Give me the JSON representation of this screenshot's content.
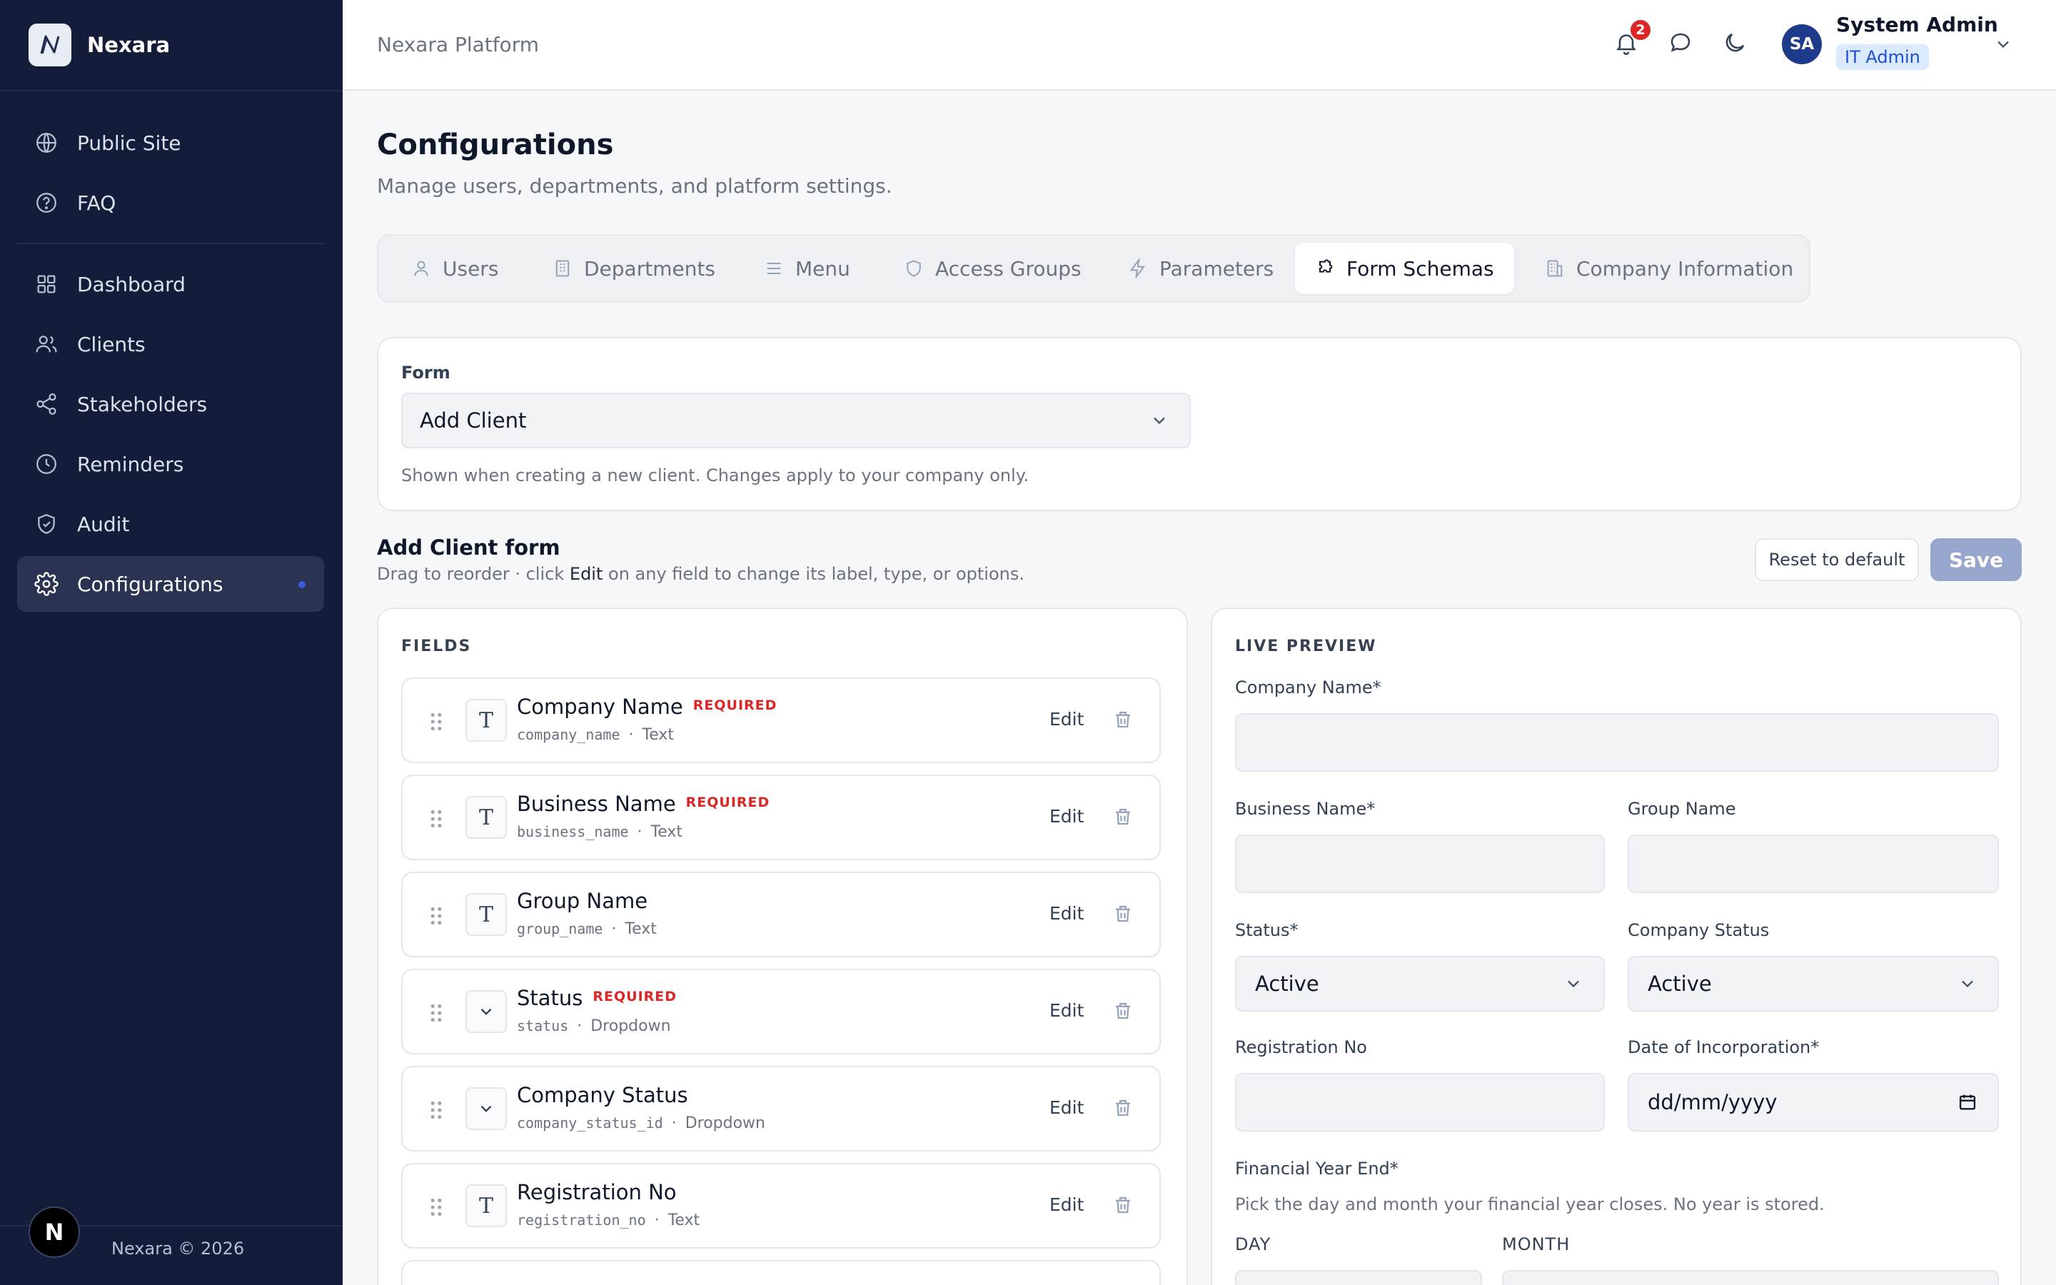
{
  "brand": {
    "name": "Nexara"
  },
  "sidebar": {
    "top_items": [
      {
        "label": "Public Site",
        "icon": "globe-icon"
      },
      {
        "label": "FAQ",
        "icon": "help-circle-icon"
      }
    ],
    "items": [
      {
        "label": "Dashboard",
        "icon": "grid-icon"
      },
      {
        "label": "Clients",
        "icon": "users-icon"
      },
      {
        "label": "Stakeholders",
        "icon": "share-icon"
      },
      {
        "label": "Reminders",
        "icon": "clock-icon"
      },
      {
        "label": "Audit",
        "icon": "shield-check-icon"
      },
      {
        "label": "Configurations",
        "icon": "gear-icon",
        "active": true
      }
    ],
    "footer_badge": "N",
    "footer_text": "Nexara © 2026"
  },
  "topbar": {
    "breadcrumb": "Nexara Platform",
    "notification_count": "2",
    "user": {
      "initials": "SA",
      "name": "System Admin",
      "role": "IT Admin"
    }
  },
  "page": {
    "title": "Configurations",
    "subtitle": "Manage users, departments, and platform settings."
  },
  "tabs": [
    {
      "label": "Users",
      "icon": "user-icon"
    },
    {
      "label": "Departments",
      "icon": "building-icon"
    },
    {
      "label": "Menu",
      "icon": "menu-icon"
    },
    {
      "label": "Access Groups",
      "icon": "shield-icon"
    },
    {
      "label": "Parameters",
      "icon": "bolt-icon"
    },
    {
      "label": "Form Schemas",
      "icon": "puzzle-icon",
      "active": true
    },
    {
      "label": "Company Information",
      "icon": "office-icon"
    }
  ],
  "form_selector": {
    "label": "Form",
    "value": "Add Client",
    "hint": "Shown when creating a new client. Changes apply to your company only."
  },
  "form_section": {
    "title": "Add Client form",
    "sub_before": "Drag to reorder · click",
    "sub_emph": "Edit",
    "sub_after": "on any field to change its label, type, or options.",
    "reset_label": "Reset to default",
    "save_label": "Save"
  },
  "fields_panel": {
    "title": "FIELDS",
    "edit_label": "Edit",
    "required_label": "REQUIRED",
    "fields": [
      {
        "label": "Company Name",
        "key": "company_name",
        "type": "Text",
        "required": true
      },
      {
        "label": "Business Name",
        "key": "business_name",
        "type": "Text",
        "required": true
      },
      {
        "label": "Group Name",
        "key": "group_name",
        "type": "Text",
        "required": false
      },
      {
        "label": "Status",
        "key": "status",
        "type": "Dropdown",
        "required": true
      },
      {
        "label": "Company Status",
        "key": "company_status_id",
        "type": "Dropdown",
        "required": false
      },
      {
        "label": "Registration No",
        "key": "registration_no",
        "type": "Text",
        "required": false
      }
    ]
  },
  "preview": {
    "title": "LIVE PREVIEW",
    "company_name_label": "Company Name*",
    "business_name_label": "Business Name*",
    "group_name_label": "Group Name",
    "status_label": "Status*",
    "status_value": "Active",
    "company_status_label": "Company Status",
    "company_status_value": "Active",
    "registration_label": "Registration No",
    "incorporation_label": "Date of Incorporation*",
    "incorporation_placeholder": "dd/mm/yyyy",
    "fy_label": "Financial Year End*",
    "fy_hint": "Pick the day and month your financial year closes. No year is stored.",
    "day_label": "DAY",
    "month_label": "MONTH"
  }
}
